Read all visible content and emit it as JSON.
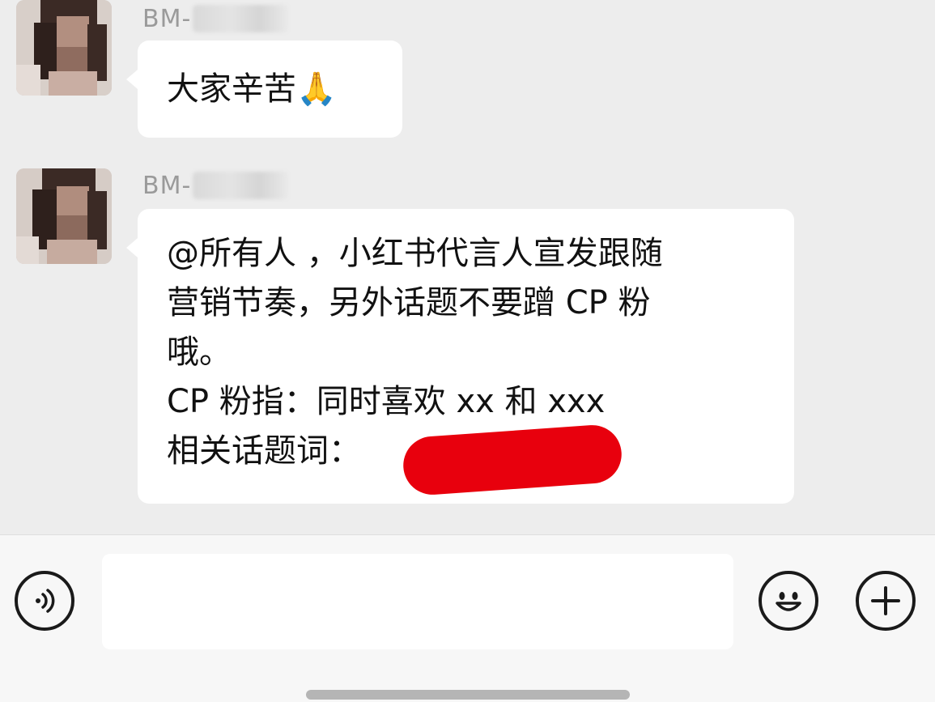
{
  "messages": [
    {
      "sender": "BM-",
      "text": "大家辛苦🙏"
    },
    {
      "sender": "BM-",
      "lines": [
        "@所有人 ，小红书代言人宣发跟随",
        "营销节奏，另外话题不要蹭 CP 粉",
        "哦。",
        "CP 粉指：同时喜欢 xx 和 xxx",
        "相关话题词："
      ]
    }
  ],
  "input_bar": {
    "placeholder": "",
    "voice_icon": "voice-icon",
    "emoji_icon": "emoji-icon",
    "plus_icon": "plus-icon"
  },
  "colors": {
    "background": "#ededed",
    "bubble": "#ffffff",
    "redaction": "#e8000d",
    "sender_text": "#9a9a9a"
  }
}
